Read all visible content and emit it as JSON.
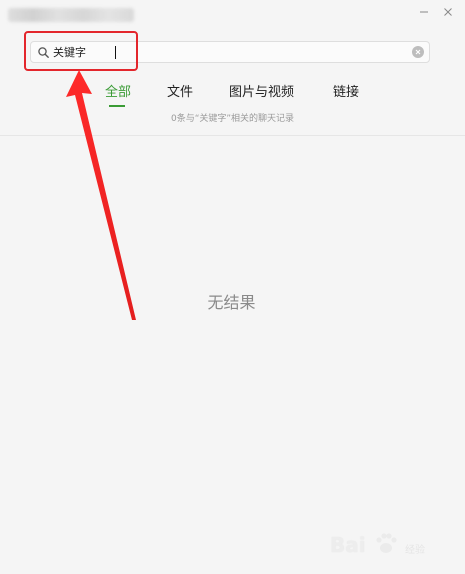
{
  "window": {
    "controls": {
      "minimize": "—",
      "close": "✕"
    }
  },
  "search": {
    "value": "关键字",
    "icon": "search-icon",
    "clear_icon": "clear-icon"
  },
  "tabs": [
    {
      "label": "全部",
      "active": true
    },
    {
      "label": "文件",
      "active": false
    },
    {
      "label": "图片与视频",
      "active": false
    },
    {
      "label": "链接",
      "active": false
    }
  ],
  "result_summary": "0条与“关键字”相关的聊天记录",
  "empty_state": "无结果",
  "annotation": {
    "color": "#e3262c"
  },
  "watermark": {
    "brand": "Bai",
    "suffix": "经验"
  },
  "colors": {
    "accent": "#3a9b35",
    "background": "#f5f5f5",
    "annotation": "#e3262c"
  }
}
